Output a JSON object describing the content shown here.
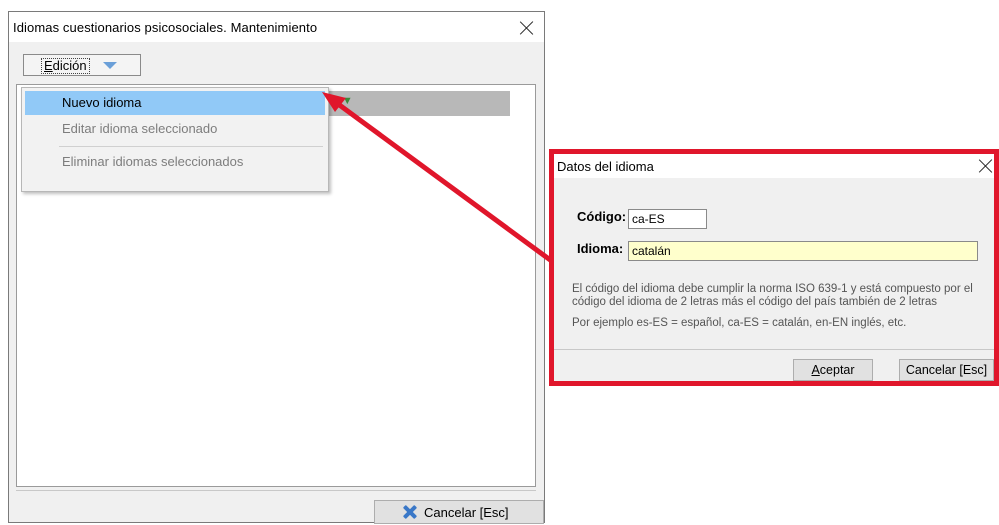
{
  "main_window": {
    "title": "Idiomas cuestionarios psicosociales. Mantenimiento",
    "edicion_button": {
      "label": "Edición",
      "accel": "E",
      "rest": "dición"
    },
    "menu": {
      "items": [
        {
          "label": "Nuevo idioma",
          "state": "highlighted"
        },
        {
          "label": "Editar idioma seleccionado",
          "state": "disabled"
        },
        {
          "label": "Eliminar idiomas seleccionados",
          "state": "disabled"
        }
      ]
    },
    "cancel_button": {
      "label": "Cancelar [Esc]"
    }
  },
  "dialog": {
    "title": "Datos del idioma",
    "codigo": {
      "label": "Código:",
      "value": "ca-ES"
    },
    "idioma": {
      "label": "Idioma:",
      "value": "catalán"
    },
    "help_lines": [
      "El código del idioma debe cumplir la norma ISO 639-1 y está compuesto por el",
      "código del idioma de 2 letras más el código del país también de 2 letras",
      "Por ejemplo es-ES = español, ca-ES = catalán, en-EN inglés, etc."
    ],
    "accept_button": {
      "label": "Aceptar",
      "accel": "A",
      "rest": "ceptar"
    },
    "cancel_button": {
      "label": "Cancelar [Esc]"
    }
  },
  "colors": {
    "highlight_box": "#e0162b",
    "menu_highlight": "#91c9f7",
    "input_yellow": "#ffffcc",
    "accent_blue": "#3a78c8"
  }
}
